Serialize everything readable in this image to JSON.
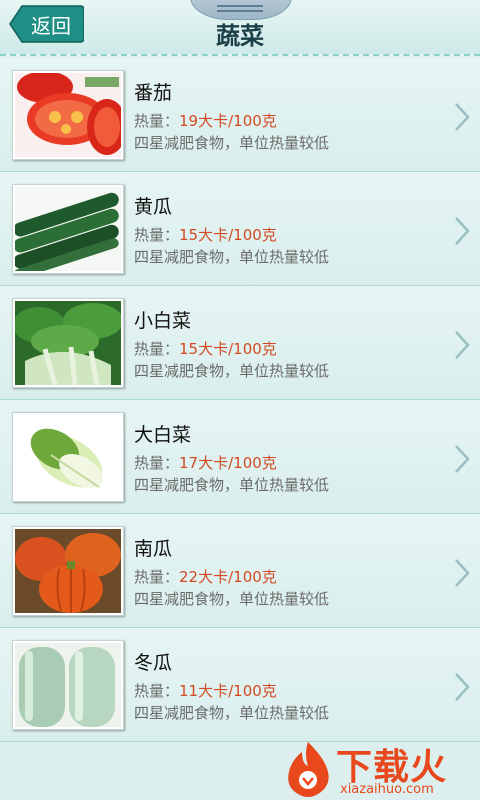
{
  "header": {
    "back_label": "返回",
    "title": "蔬菜"
  },
  "kcal_label": "热量：",
  "items": [
    {
      "name": "番茄",
      "kcal": "19大卡/100克",
      "desc": "四星减肥食物，单位热量较低"
    },
    {
      "name": "黄瓜",
      "kcal": "15大卡/100克",
      "desc": "四星减肥食物，单位热量较低"
    },
    {
      "name": "小白菜",
      "kcal": "15大卡/100克",
      "desc": "四星减肥食物，单位热量较低"
    },
    {
      "name": "大白菜",
      "kcal": "17大卡/100克",
      "desc": "四星减肥食物，单位热量较低"
    },
    {
      "name": "南瓜",
      "kcal": "22大卡/100克",
      "desc": "四星减肥食物，单位热量较低"
    },
    {
      "name": "冬瓜",
      "kcal": "11大卡/100克",
      "desc": "四星减肥食物，单位热量较低"
    }
  ],
  "watermark": {
    "main": "下载火",
    "sub": "xiazaihuo.com"
  },
  "colors": {
    "accent": "#d24a22",
    "header_teal": "#1f8f86",
    "background": "#dcefee"
  }
}
